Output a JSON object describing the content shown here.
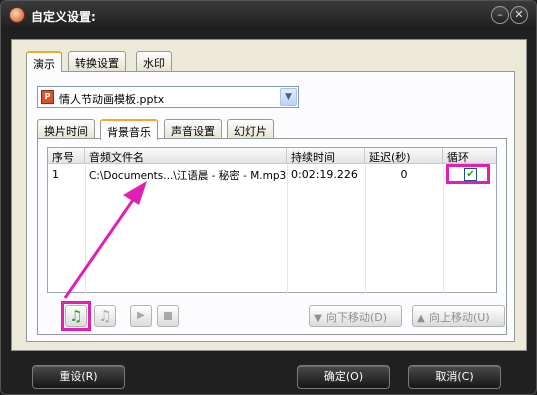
{
  "window": {
    "title": "自定义设置:"
  },
  "top_tabs": [
    {
      "label": "演示"
    },
    {
      "label": "转换设置"
    },
    {
      "label": "水印"
    }
  ],
  "file_select": {
    "value": "情人节动画模板.pptx"
  },
  "sub_tabs": [
    {
      "label": "换片时间"
    },
    {
      "label": "背景音乐"
    },
    {
      "label": "声音设置"
    },
    {
      "label": "幻灯片"
    }
  ],
  "music_table": {
    "columns": [
      "序号",
      "音频文件名",
      "持续时间",
      "延迟(秒)",
      "循环"
    ],
    "rows": [
      {
        "index": "1",
        "file": "C:\\Documents...\\江语晨 - 秘密 - M.mp3",
        "duration": "0:02:19.226",
        "delay": "0",
        "loop": true
      }
    ]
  },
  "toolbar": {
    "move_down": "向下移动(D)",
    "move_up": "向上移动(U)"
  },
  "footer": {
    "reset": "重设(R)",
    "ok": "确定(O)",
    "cancel": "取消(C)"
  },
  "colors": {
    "highlight": "#e020b0",
    "accent_tab": "#f0a830"
  }
}
